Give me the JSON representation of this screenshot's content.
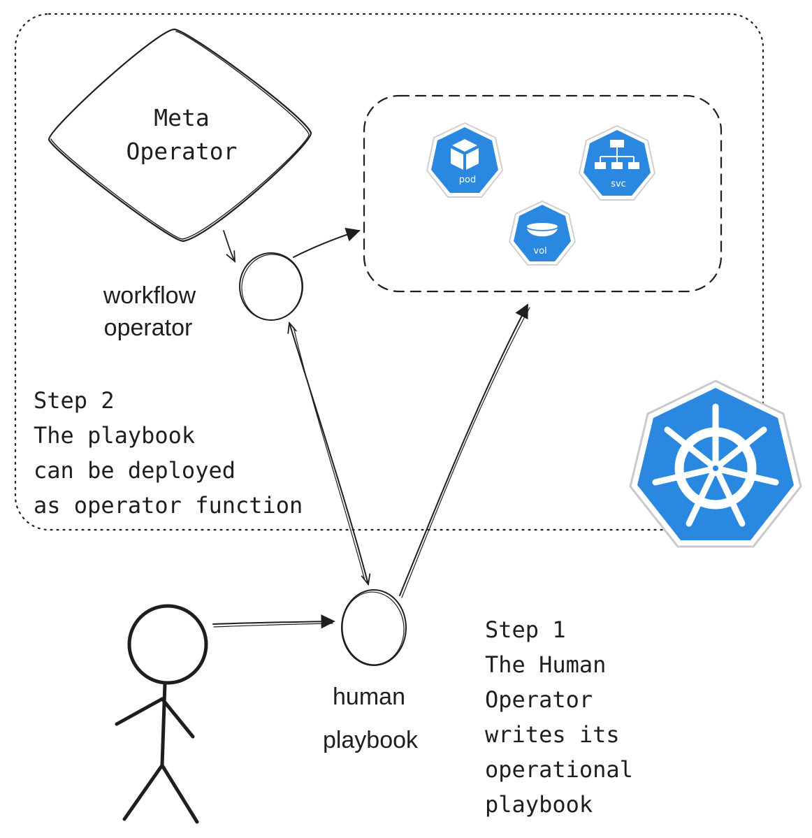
{
  "diagram": {
    "meta_operator_label": [
      "Meta",
      "Operator"
    ],
    "workflow_operator_label": [
      "workflow",
      "operator"
    ],
    "human_playbook_label": [
      "human",
      "playbook"
    ],
    "step2_text": [
      "Step 2",
      "The playbook",
      "can be deployed",
      "as operator function"
    ],
    "step1_text": [
      "Step 1",
      "The Human",
      "Operator",
      "writes its",
      "operational",
      "playbook"
    ],
    "resources": [
      {
        "name": "pod",
        "label": "pod"
      },
      {
        "name": "svc",
        "label": "svc"
      },
      {
        "name": "vol",
        "label": "vol"
      }
    ],
    "colors": {
      "ink": "#1e1e1e",
      "k8s_blue": "#2b88e0",
      "k8s_border": "#c9c9c9"
    },
    "icons": [
      "kubernetes-logo",
      "pod-icon",
      "svc-icon",
      "vol-icon",
      "stick-figure-icon"
    ]
  }
}
